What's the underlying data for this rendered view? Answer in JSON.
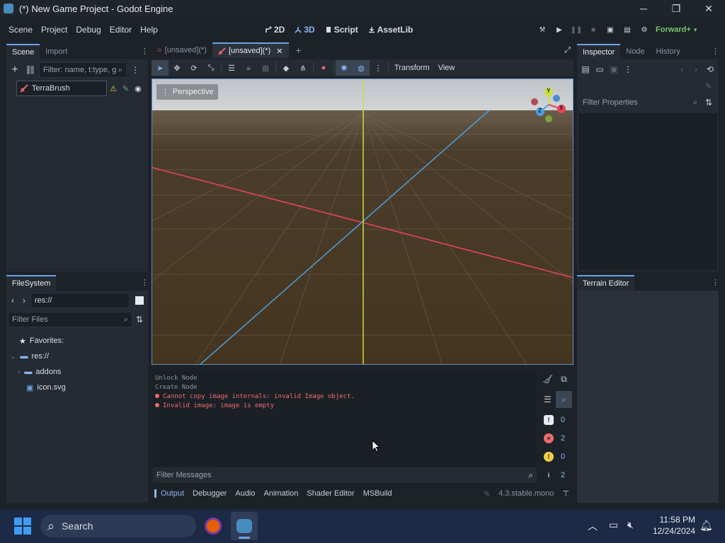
{
  "window": {
    "title": "(*) New Game Project - Godot Engine",
    "minimize_glyph": "─",
    "restore_glyph": "❐",
    "close_glyph": "✕"
  },
  "menu": {
    "items": [
      "Scene",
      "Project",
      "Debug",
      "Editor",
      "Help"
    ]
  },
  "workspaces": {
    "items": [
      {
        "label": "2D",
        "icon": "2d-icon"
      },
      {
        "label": "3D",
        "icon": "3d-icon",
        "active": true
      },
      {
        "label": "Script",
        "icon": "script-icon"
      },
      {
        "label": "AssetLib",
        "icon": "assetlib-icon"
      }
    ]
  },
  "run_bar": {
    "renderer": "Forward+"
  },
  "scene_dock": {
    "tabs": [
      "Scene",
      "Import"
    ],
    "filter_placeholder": "Filter: name, t:type, g",
    "root_node": "TerraBrush"
  },
  "filesystem_dock": {
    "title": "FileSystem",
    "path": "res://",
    "filter_placeholder": "Filter Files",
    "items": [
      {
        "label": "Favorites:",
        "icon": "star-icon"
      },
      {
        "label": "res://",
        "icon": "folder-icon"
      },
      {
        "label": "addons",
        "icon": "folder-icon"
      },
      {
        "label": "icon.svg",
        "icon": "image-icon"
      }
    ]
  },
  "editor_tabs": {
    "items": [
      {
        "label": "[unsaved](*)",
        "active": false
      },
      {
        "label": "[unsaved](*)",
        "active": true
      }
    ]
  },
  "viewport_toolbar": {
    "transform_label": "Transform",
    "view_label": "View"
  },
  "viewport": {
    "perspective_label": "Perspective",
    "gizmo": {
      "x": "X",
      "y": "Y",
      "z": "Z"
    },
    "colors": {
      "x_axis": "#e8455a",
      "y_axis": "#c6e23a",
      "z_axis": "#4a9fe0",
      "ground": "#4a3b28",
      "sky": "#c9ccd0"
    }
  },
  "output": {
    "lines": [
      {
        "text": "Unlock Node",
        "type": "info"
      },
      {
        "text": "Create Node",
        "type": "info"
      },
      {
        "text": "Cannot copy image internals: invalid Image object.",
        "type": "error"
      },
      {
        "text": "Invalid image: image is empty",
        "type": "error"
      }
    ],
    "filter_placeholder": "Filter Messages",
    "counters": [
      {
        "icon": "message-icon",
        "value": "0",
        "color": "#e6e9ee",
        "symbol": "!"
      },
      {
        "icon": "error-icon",
        "value": "2",
        "color": "#ef6b6b",
        "symbol": "×"
      },
      {
        "icon": "warning-icon",
        "value": "0",
        "color": "#f2cf4a",
        "symbol": "!"
      },
      {
        "icon": "info-icon",
        "value": "2",
        "color": "#c8cdd3",
        "symbol": "i"
      }
    ]
  },
  "bottom_panel": {
    "tabs": [
      "Output",
      "Debugger",
      "Audio",
      "Animation",
      "Shader Editor",
      "MSBuild"
    ],
    "version": "4.3.stable.mono"
  },
  "inspector_dock": {
    "tabs": [
      "Inspector",
      "Node",
      "History"
    ],
    "filter_placeholder": "Filter Properties"
  },
  "terrain_dock": {
    "title": "Terrain Editor"
  },
  "taskbar": {
    "search_label": "Search",
    "time": "11:58 PM",
    "date": "12/24/2024"
  }
}
